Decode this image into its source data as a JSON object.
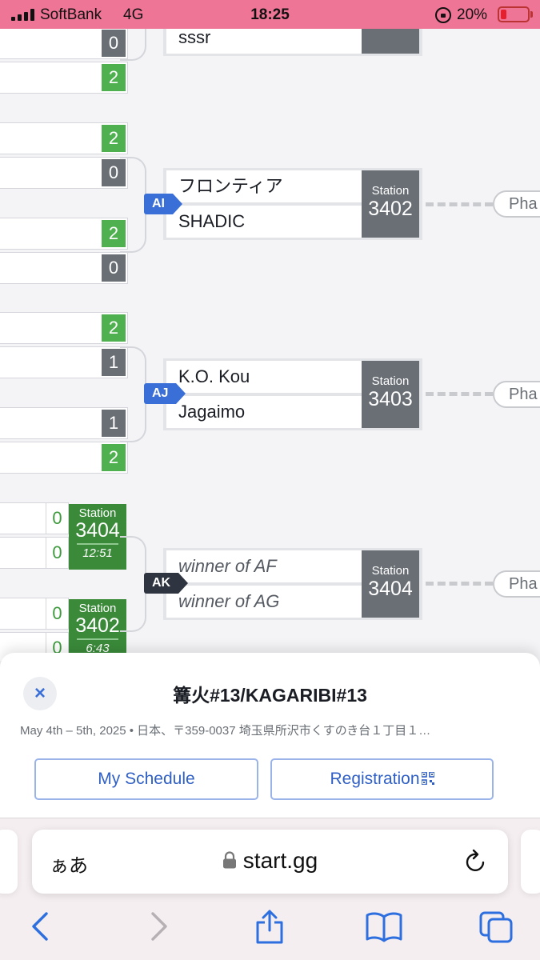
{
  "status_bar": {
    "carrier": "SoftBank",
    "network": "4G",
    "time": "18:25",
    "battery": "20%",
    "battery_level": 0.2,
    "battery_color": "#e4202e",
    "background": "#ee7595"
  },
  "bracket": {
    "left_scores": [
      {
        "score": "0",
        "result": "lose"
      },
      {
        "score": "2",
        "result": "win"
      },
      {
        "score": "2",
        "result": "win"
      },
      {
        "score": "0",
        "result": "lose"
      },
      {
        "score": "2",
        "result": "win"
      },
      {
        "score": "0",
        "result": "lose"
      },
      {
        "score": "2",
        "result": "win"
      },
      {
        "score": "1",
        "result": "lose"
      },
      {
        "score": "1",
        "result": "lose"
      },
      {
        "score": "2",
        "result": "win"
      }
    ],
    "ongoing": [
      {
        "scores": [
          "0",
          "0"
        ],
        "station_label": "Station",
        "station": "3404",
        "time": "12:51"
      },
      {
        "scores": [
          "0",
          "0"
        ],
        "station_label": "Station",
        "station": "3402",
        "time": "6:43"
      }
    ],
    "top_partial_match": {
      "player": "sssr"
    },
    "matches": [
      {
        "id": "AI",
        "players": [
          "フロンティア",
          "SHADIC"
        ],
        "station_label": "Station",
        "station": "3402",
        "phase": "Pha",
        "tbd": false
      },
      {
        "id": "AJ",
        "players": [
          "K.O. Kou",
          "Jagaimo"
        ],
        "station_label": "Station",
        "station": "3403",
        "phase": "Pha",
        "tbd": false
      },
      {
        "id": "AK",
        "players": [
          "winner of AF",
          "winner of AG"
        ],
        "station_label": "Station",
        "station": "3404",
        "phase": "Pha",
        "tbd": true
      }
    ],
    "colors": {
      "win": "#4fb04f",
      "lose": "#6a6f76",
      "ongoing": "#3a8a3a",
      "tag_active": "#3a6fd8",
      "tag_pending": "#2e3440"
    }
  },
  "sheet": {
    "close_icon": "×",
    "title": "篝火#13/KAGARIBI#13",
    "meta": "May 4th – 5th, 2025 • 日本、〒359-0037 埼玉県所沢市くすのき台１丁目１…",
    "my_schedule": "My Schedule",
    "registration": "Registration"
  },
  "safari": {
    "aa": "ぁあ",
    "url": "start.gg"
  }
}
